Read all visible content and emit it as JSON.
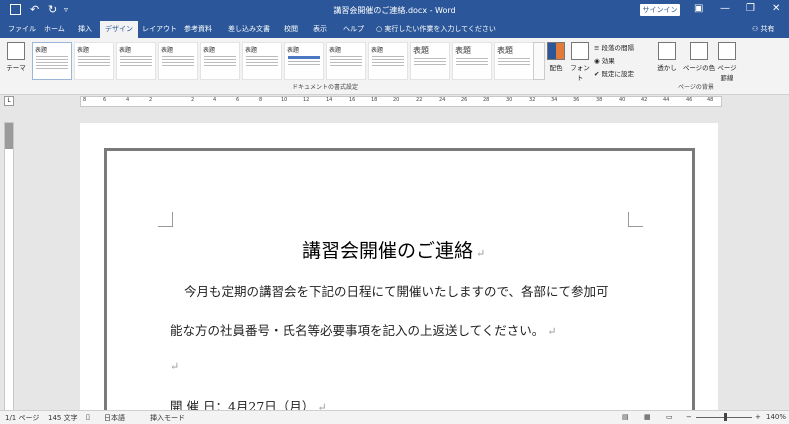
{
  "titlebar": {
    "doc_title": "講習会開催のご連絡.docx - Word",
    "signin_label": "サインイン",
    "save_icon": "save-icon",
    "undo_glyph": "↶",
    "redo_glyph": "↻",
    "qa_more": "▿",
    "ribbon_display_glyph": "▣",
    "min_glyph": "—",
    "max_glyph": "❐",
    "close_glyph": "✕"
  },
  "tabs": [
    {
      "label": "ファイル"
    },
    {
      "label": "ホーム"
    },
    {
      "label": "挿入"
    },
    {
      "label": "デザイン"
    },
    {
      "label": "レイアウト"
    },
    {
      "label": "参考資料"
    },
    {
      "label": "差し込み文書"
    },
    {
      "label": "校閲"
    },
    {
      "label": "表示"
    },
    {
      "label": "ヘルプ"
    }
  ],
  "tell_me": "実行したい作業を入力してください",
  "share": "共有",
  "ribbon": {
    "theme_label": "テーマ",
    "style_titles": [
      "表題",
      "表題",
      "表題",
      "表題",
      "表題",
      "表題",
      "表題",
      "表題",
      "表題",
      "表題",
      "表題"
    ],
    "colors_label": "配色",
    "fonts_label": "フォント",
    "paragraph_spacing": "段落の間隔",
    "effects": "効果",
    "set_default": "既定に設定",
    "group_formatting": "ドキュメントの書式設定",
    "watermark": "透かし",
    "page_color": "ページの色",
    "page_borders": "ページ罫線",
    "group_background": "ページの背景"
  },
  "ruler": {
    "corner": "L",
    "numbers": [
      "8",
      "6",
      "4",
      "2",
      "2",
      "4",
      "6",
      "8",
      "10",
      "12",
      "14",
      "16",
      "18",
      "20",
      "22",
      "24",
      "26",
      "28",
      "30",
      "32",
      "34",
      "36",
      "38",
      "40",
      "42",
      "44",
      "46",
      "48"
    ]
  },
  "document": {
    "heading": "講習会開催のご連絡",
    "paragraph1_line1": "今月も定期の講習会を下記の日程にて開催いたしますので、各部にて参加可",
    "paragraph1_line2": "能な方の社員番号・氏名等必要事項を記入の上返送してください。",
    "empty_line": "",
    "date_line": "開 催 日：4月27日（月）",
    "paragraph_mark": "↵"
  },
  "status": {
    "page": "1/1 ページ",
    "words": "145 文字",
    "language": "日本語",
    "mode": "挿入モード",
    "zoom_minus": "−",
    "zoom_plus": "+",
    "zoom": "140%"
  }
}
